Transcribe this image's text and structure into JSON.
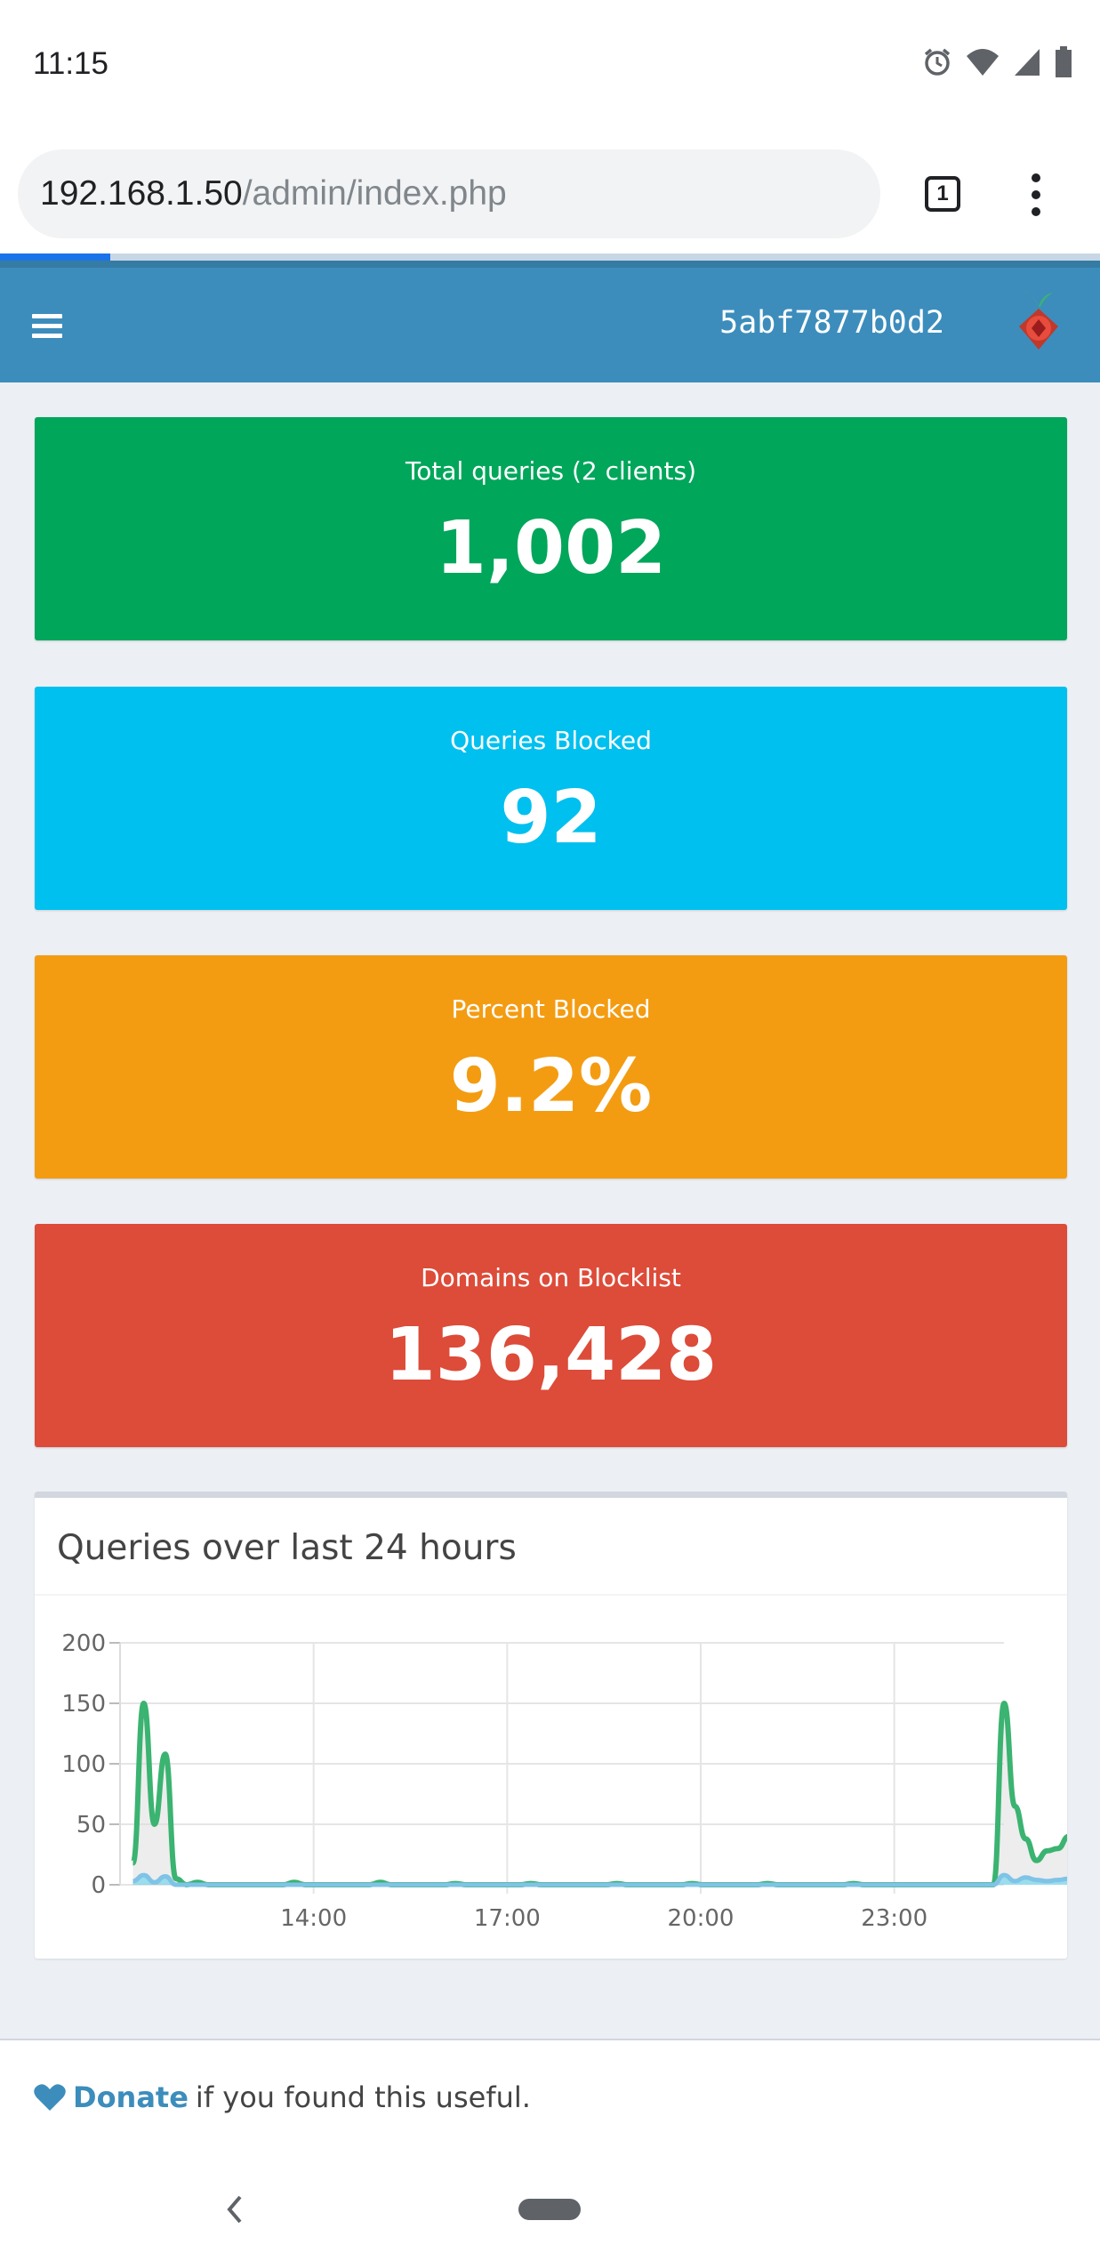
{
  "status_bar": {
    "time": "11:15",
    "icons": [
      "alarm-icon",
      "wifi-icon",
      "signal-icon",
      "battery-icon"
    ]
  },
  "browser": {
    "url_host": "192.168.1.50",
    "url_path": "/admin/index.php",
    "tab_count": "1",
    "load_progress": 0.1
  },
  "navbar": {
    "hostname": "5abf7877b0d2"
  },
  "stats": [
    {
      "title": "Total queries (2 clients)",
      "value": "1,002",
      "color": "#00a65a"
    },
    {
      "title": "Queries Blocked",
      "value": "92",
      "color": "#00c0ef"
    },
    {
      "title": "Percent Blocked",
      "value": "9.2%",
      "color": "#f39c12"
    },
    {
      "title": "Domains on Blocklist",
      "value": "136,428",
      "color": "#dd4b39"
    }
  ],
  "chart_panel": {
    "title": "Queries over last 24 hours"
  },
  "chart_data": {
    "type": "area",
    "x_ticks": [
      "14:00",
      "17:00",
      "20:00",
      "23:00"
    ],
    "ylim": [
      0,
      200
    ],
    "y_ticks": [
      "0",
      "50",
      "100",
      "150",
      "200"
    ],
    "grid": true,
    "x_start_hour": 11.0,
    "x_end_hour": 24.7,
    "x_step_hours": 0.1667,
    "series": [
      {
        "color": "#3bb371",
        "fill": "rgba(220,220,220,0.5)",
        "values": [
          18,
          150,
          50,
          108,
          5,
          0,
          2,
          0,
          0,
          0,
          0,
          0,
          0,
          0,
          0,
          2,
          0,
          0,
          0,
          0,
          0,
          0,
          0,
          2,
          0,
          0,
          0,
          0,
          0,
          0,
          1,
          0,
          0,
          0,
          0,
          0,
          0,
          1,
          0,
          0,
          0,
          0,
          0,
          0,
          0,
          1,
          0,
          0,
          0,
          0,
          0,
          0,
          1,
          0,
          0,
          0,
          0,
          0,
          0,
          1,
          0,
          0,
          0,
          0,
          0,
          0,
          0,
          1,
          0,
          0,
          0,
          0,
          0,
          0,
          0,
          0,
          0,
          0,
          0,
          0,
          0,
          150,
          65,
          38,
          20,
          28,
          30,
          40,
          22,
          58,
          25,
          23,
          36,
          30,
          26,
          62,
          0,
          0,
          0
        ]
      },
      {
        "color": "#7fc3e7",
        "fill": "rgba(0,192,239,0.35)",
        "values": [
          3,
          8,
          2,
          7,
          0,
          0,
          0,
          0,
          0,
          0,
          0,
          0,
          0,
          0,
          0,
          0,
          0,
          0,
          0,
          0,
          0,
          0,
          0,
          0,
          0,
          0,
          0,
          0,
          0,
          0,
          0,
          0,
          0,
          0,
          0,
          0,
          0,
          0,
          0,
          0,
          0,
          0,
          0,
          0,
          0,
          0,
          0,
          0,
          0,
          0,
          0,
          0,
          0,
          0,
          0,
          0,
          0,
          0,
          0,
          0,
          0,
          0,
          0,
          0,
          0,
          0,
          0,
          0,
          0,
          0,
          0,
          0,
          0,
          0,
          0,
          0,
          0,
          0,
          0,
          0,
          0,
          8,
          3,
          6,
          4,
          3,
          4,
          5,
          3,
          5,
          4,
          4,
          5,
          4,
          4,
          5,
          0,
          0,
          0
        ]
      }
    ]
  },
  "footer": {
    "donate_label": "Donate",
    "donate_suffix": "if you found this useful."
  }
}
